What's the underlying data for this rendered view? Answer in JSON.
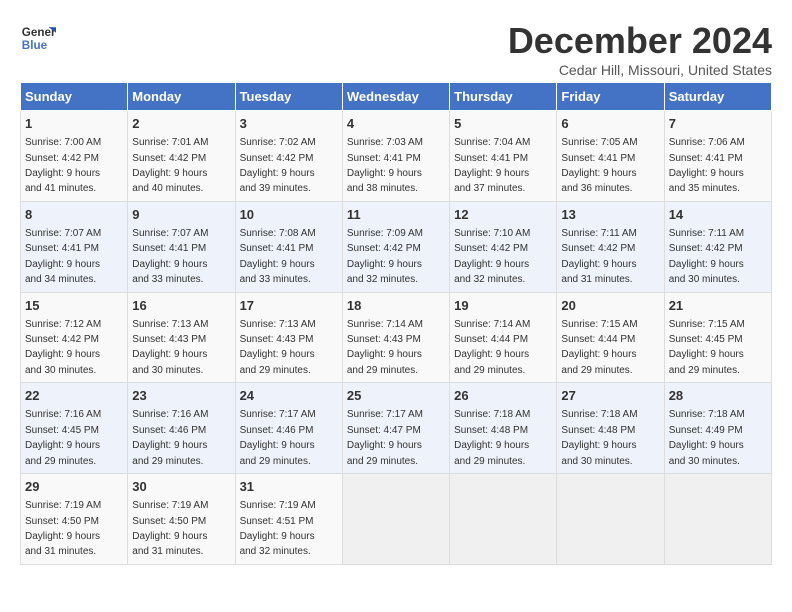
{
  "logo": {
    "line1": "General",
    "line2": "Blue"
  },
  "title": "December 2024",
  "location": "Cedar Hill, Missouri, United States",
  "days_header": [
    "Sunday",
    "Monday",
    "Tuesday",
    "Wednesday",
    "Thursday",
    "Friday",
    "Saturday"
  ],
  "weeks": [
    [
      {
        "day": "1",
        "info": "Sunrise: 7:00 AM\nSunset: 4:42 PM\nDaylight: 9 hours\nand 41 minutes."
      },
      {
        "day": "2",
        "info": "Sunrise: 7:01 AM\nSunset: 4:42 PM\nDaylight: 9 hours\nand 40 minutes."
      },
      {
        "day": "3",
        "info": "Sunrise: 7:02 AM\nSunset: 4:42 PM\nDaylight: 9 hours\nand 39 minutes."
      },
      {
        "day": "4",
        "info": "Sunrise: 7:03 AM\nSunset: 4:41 PM\nDaylight: 9 hours\nand 38 minutes."
      },
      {
        "day": "5",
        "info": "Sunrise: 7:04 AM\nSunset: 4:41 PM\nDaylight: 9 hours\nand 37 minutes."
      },
      {
        "day": "6",
        "info": "Sunrise: 7:05 AM\nSunset: 4:41 PM\nDaylight: 9 hours\nand 36 minutes."
      },
      {
        "day": "7",
        "info": "Sunrise: 7:06 AM\nSunset: 4:41 PM\nDaylight: 9 hours\nand 35 minutes."
      }
    ],
    [
      {
        "day": "8",
        "info": "Sunrise: 7:07 AM\nSunset: 4:41 PM\nDaylight: 9 hours\nand 34 minutes."
      },
      {
        "day": "9",
        "info": "Sunrise: 7:07 AM\nSunset: 4:41 PM\nDaylight: 9 hours\nand 33 minutes."
      },
      {
        "day": "10",
        "info": "Sunrise: 7:08 AM\nSunset: 4:41 PM\nDaylight: 9 hours\nand 33 minutes."
      },
      {
        "day": "11",
        "info": "Sunrise: 7:09 AM\nSunset: 4:42 PM\nDaylight: 9 hours\nand 32 minutes."
      },
      {
        "day": "12",
        "info": "Sunrise: 7:10 AM\nSunset: 4:42 PM\nDaylight: 9 hours\nand 32 minutes."
      },
      {
        "day": "13",
        "info": "Sunrise: 7:11 AM\nSunset: 4:42 PM\nDaylight: 9 hours\nand 31 minutes."
      },
      {
        "day": "14",
        "info": "Sunrise: 7:11 AM\nSunset: 4:42 PM\nDaylight: 9 hours\nand 30 minutes."
      }
    ],
    [
      {
        "day": "15",
        "info": "Sunrise: 7:12 AM\nSunset: 4:42 PM\nDaylight: 9 hours\nand 30 minutes."
      },
      {
        "day": "16",
        "info": "Sunrise: 7:13 AM\nSunset: 4:43 PM\nDaylight: 9 hours\nand 30 minutes."
      },
      {
        "day": "17",
        "info": "Sunrise: 7:13 AM\nSunset: 4:43 PM\nDaylight: 9 hours\nand 29 minutes."
      },
      {
        "day": "18",
        "info": "Sunrise: 7:14 AM\nSunset: 4:43 PM\nDaylight: 9 hours\nand 29 minutes."
      },
      {
        "day": "19",
        "info": "Sunrise: 7:14 AM\nSunset: 4:44 PM\nDaylight: 9 hours\nand 29 minutes."
      },
      {
        "day": "20",
        "info": "Sunrise: 7:15 AM\nSunset: 4:44 PM\nDaylight: 9 hours\nand 29 minutes."
      },
      {
        "day": "21",
        "info": "Sunrise: 7:15 AM\nSunset: 4:45 PM\nDaylight: 9 hours\nand 29 minutes."
      }
    ],
    [
      {
        "day": "22",
        "info": "Sunrise: 7:16 AM\nSunset: 4:45 PM\nDaylight: 9 hours\nand 29 minutes."
      },
      {
        "day": "23",
        "info": "Sunrise: 7:16 AM\nSunset: 4:46 PM\nDaylight: 9 hours\nand 29 minutes."
      },
      {
        "day": "24",
        "info": "Sunrise: 7:17 AM\nSunset: 4:46 PM\nDaylight: 9 hours\nand 29 minutes."
      },
      {
        "day": "25",
        "info": "Sunrise: 7:17 AM\nSunset: 4:47 PM\nDaylight: 9 hours\nand 29 minutes."
      },
      {
        "day": "26",
        "info": "Sunrise: 7:18 AM\nSunset: 4:48 PM\nDaylight: 9 hours\nand 29 minutes."
      },
      {
        "day": "27",
        "info": "Sunrise: 7:18 AM\nSunset: 4:48 PM\nDaylight: 9 hours\nand 30 minutes."
      },
      {
        "day": "28",
        "info": "Sunrise: 7:18 AM\nSunset: 4:49 PM\nDaylight: 9 hours\nand 30 minutes."
      }
    ],
    [
      {
        "day": "29",
        "info": "Sunrise: 7:19 AM\nSunset: 4:50 PM\nDaylight: 9 hours\nand 31 minutes."
      },
      {
        "day": "30",
        "info": "Sunrise: 7:19 AM\nSunset: 4:50 PM\nDaylight: 9 hours\nand 31 minutes."
      },
      {
        "day": "31",
        "info": "Sunrise: 7:19 AM\nSunset: 4:51 PM\nDaylight: 9 hours\nand 32 minutes."
      },
      null,
      null,
      null,
      null
    ]
  ]
}
